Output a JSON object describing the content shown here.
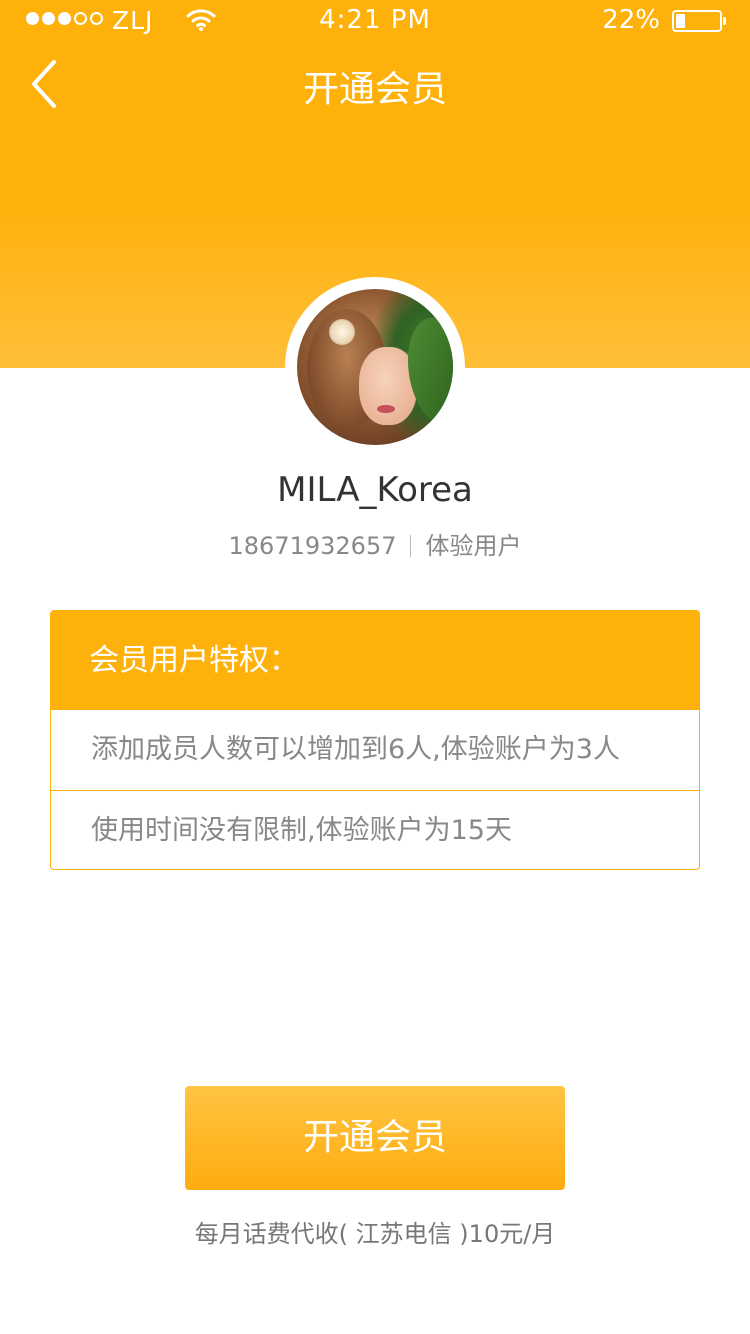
{
  "status_bar": {
    "carrier": "ZLJ",
    "time": "4:21 PM",
    "battery_percent": "22%",
    "battery_level": 0.22,
    "signal_bars_filled": 3,
    "signal_bars_total": 5
  },
  "nav": {
    "title": "开通会员",
    "back_icon": "chevron-left-icon"
  },
  "profile": {
    "username": "MILA_Korea",
    "phone": "18671932657",
    "user_type": "体验用户"
  },
  "privileges": {
    "title": "会员用户特权：",
    "items": [
      "添加成员人数可以增加到6人,体验账户为3人",
      "使用时间没有限制,体验账户为15天"
    ]
  },
  "action": {
    "button_label": "开通会员",
    "fee_note": "每月话费代收( 江苏电信 )10元/月"
  },
  "colors": {
    "accent": "#ffb10b",
    "text_primary": "#333333",
    "text_secondary": "#888888"
  }
}
